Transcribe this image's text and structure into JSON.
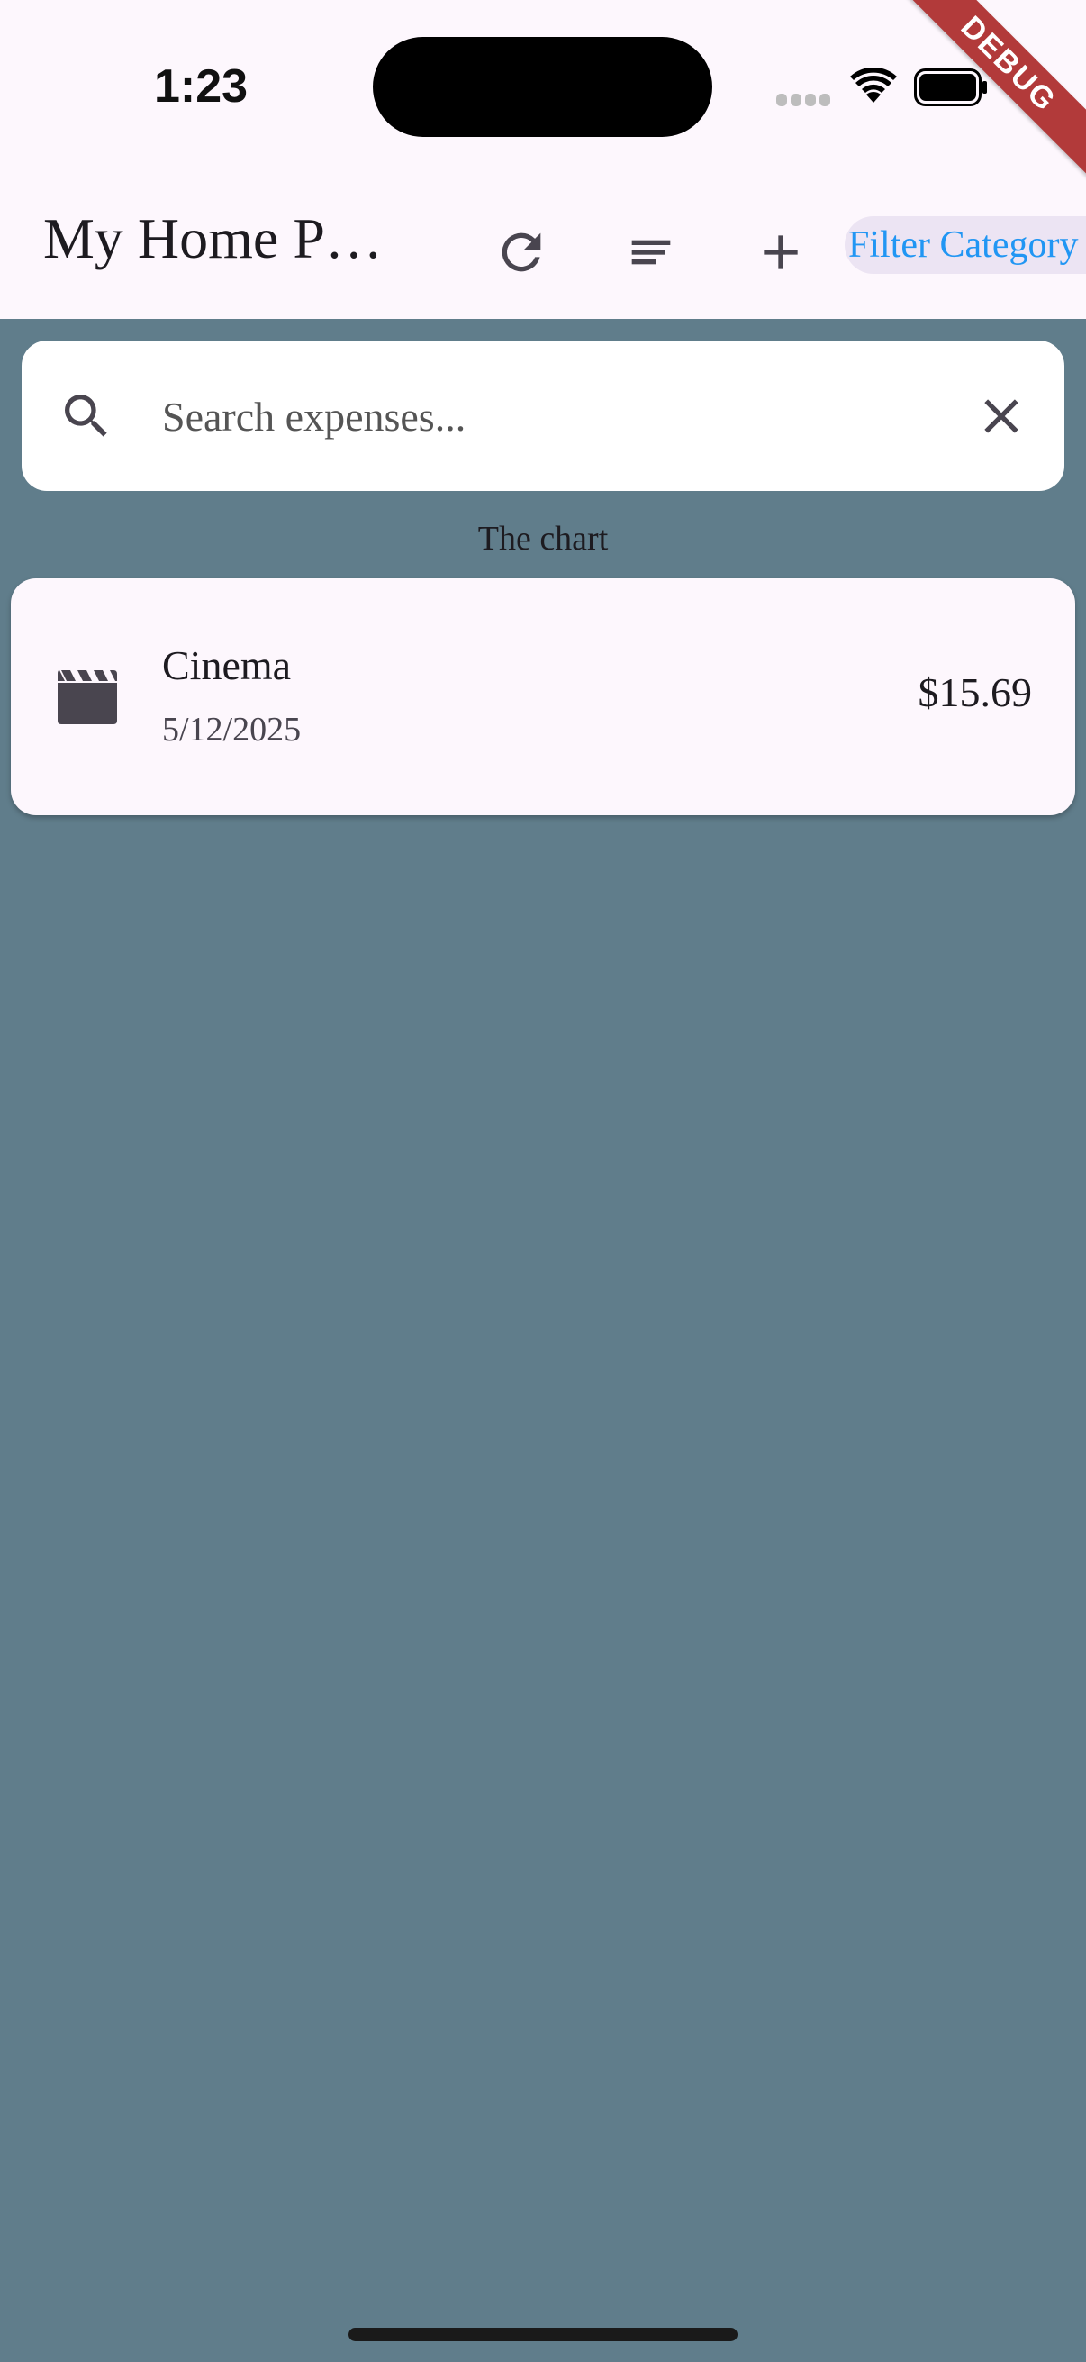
{
  "status_bar": {
    "time": "1:23"
  },
  "debug_banner": "DEBUG",
  "app_bar": {
    "title": "My Home P…",
    "filter_label": "Filter Category"
  },
  "search": {
    "placeholder": "Search expenses...",
    "value": ""
  },
  "chart_caption": "The chart",
  "expenses": [
    {
      "name": "Cinema",
      "date": "5/12/2025",
      "amount": "$15.69",
      "icon": "movie-clapper-icon"
    }
  ],
  "colors": {
    "background": "#607d8b",
    "app_bar": "#fdf7fd",
    "filter_text": "#2196f3",
    "debug": "#b23a3a"
  }
}
